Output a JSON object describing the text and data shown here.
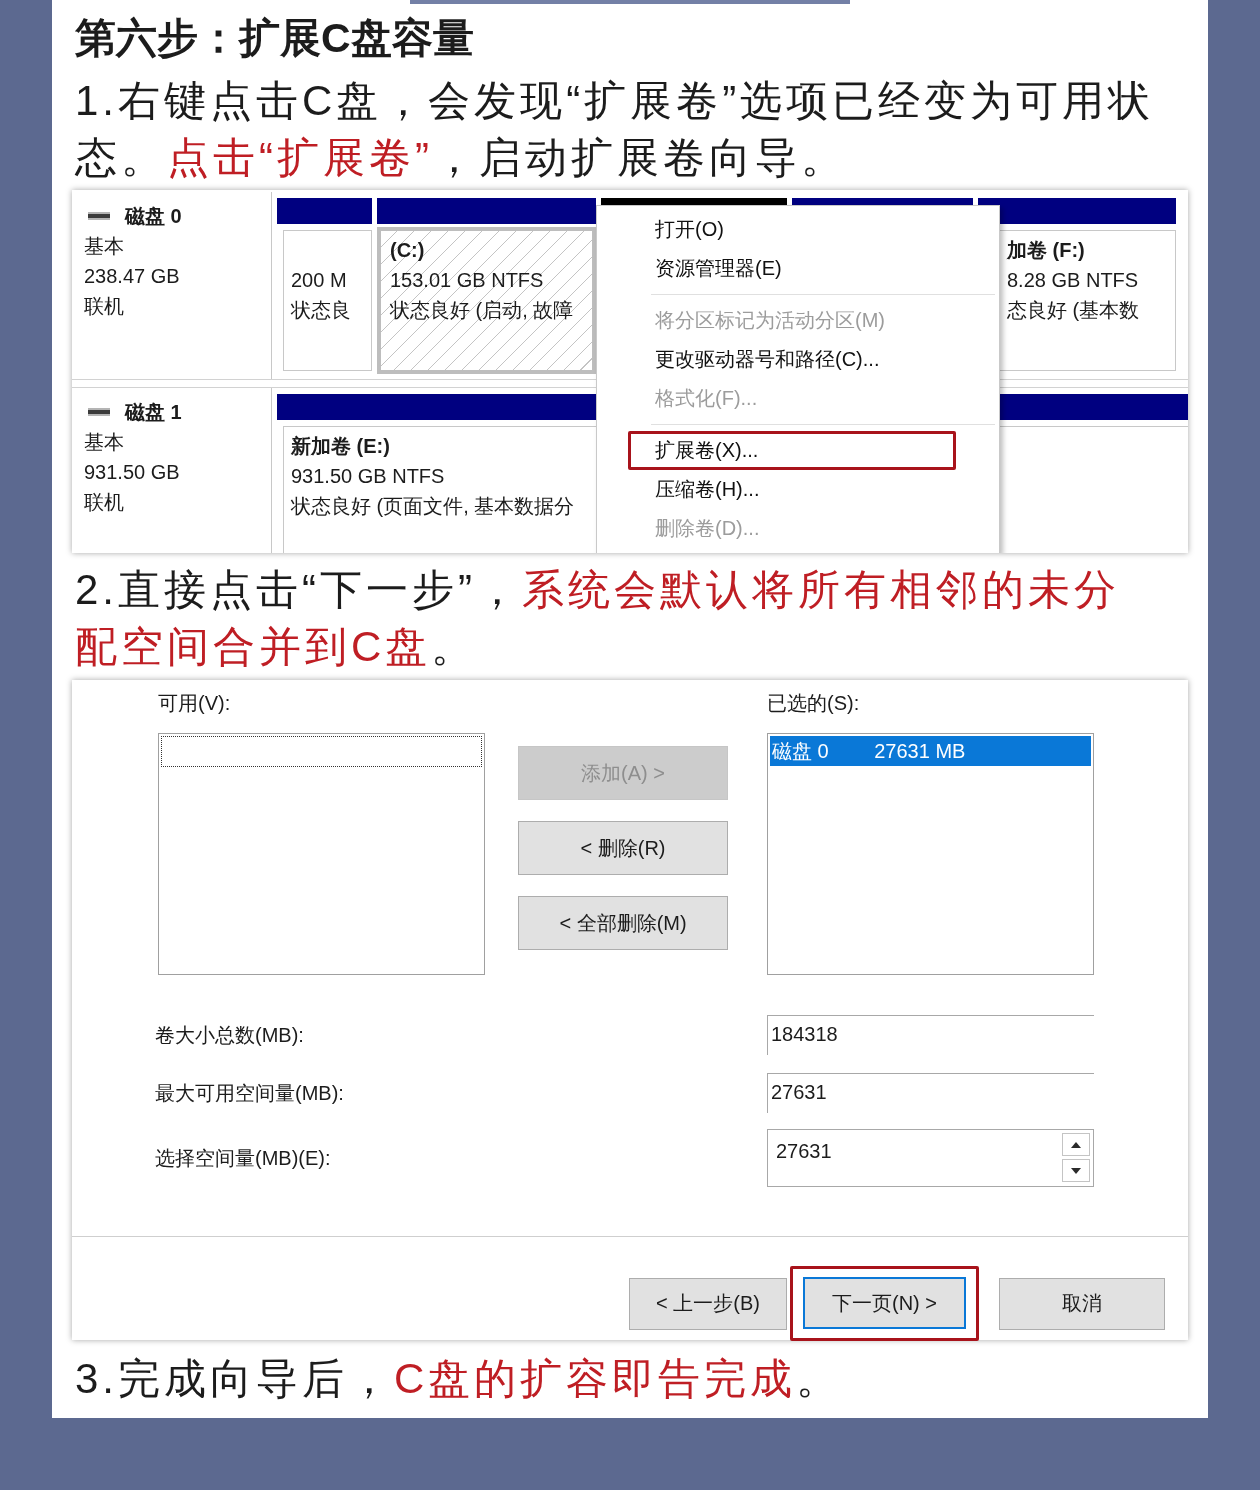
{
  "heading": "第六步：扩展C盘容量",
  "step_1": {
    "text": [
      {
        "text": "1.右键点击C盘，会发现“扩展卷”选项已经变为可用状态。",
        "highlight": false
      },
      {
        "text": "点击“扩展卷”",
        "highlight": true
      },
      {
        "text": "，启动扩展卷向导。",
        "highlight": false
      }
    ]
  },
  "disk_management": {
    "disks": [
      {
        "name": "磁盘 0",
        "type": "基本",
        "size": "238.47 GB",
        "status": "联机",
        "partitions": [
          {
            "kind": "volume",
            "color": "#000080",
            "selected": false,
            "capacity": "200 M",
            "state": "状态良"
          },
          {
            "kind": "volume",
            "color": "#000080",
            "selected": true,
            "title": "(C:)",
            "capacity": "153.01 GB NTFS",
            "state": "状态良好 (启动, 故障"
          },
          {
            "kind": "covered",
            "color": "#000000",
            "selected": false
          },
          {
            "kind": "covered",
            "color": "#000080",
            "selected": false
          },
          {
            "kind": "volume",
            "color": "#000080",
            "selected": false,
            "title": "加卷 (F:)",
            "capacity": "8.28 GB NTFS",
            "state": "态良好 (基本数"
          }
        ]
      },
      {
        "name": "磁盘 1",
        "type": "基本",
        "size": "931.50 GB",
        "status": "联机",
        "partitions": [
          {
            "kind": "volume",
            "color": "#000080",
            "selected": false,
            "title": "新加卷 (E:)",
            "capacity": "931.50 GB NTFS",
            "state": "状态良好 (页面文件, 基本数据分"
          }
        ]
      }
    ],
    "context_menu": {
      "items": [
        {
          "kind": "item",
          "label": "打开(O)",
          "disabled": false,
          "annotated": false
        },
        {
          "kind": "item",
          "label": "资源管理器(E)",
          "disabled": false,
          "annotated": false
        },
        {
          "kind": "separator"
        },
        {
          "kind": "item",
          "label": "将分区标记为活动分区(M)",
          "disabled": true,
          "annotated": false
        },
        {
          "kind": "item",
          "label": "更改驱动器号和路径(C)...",
          "disabled": false,
          "annotated": false
        },
        {
          "kind": "item",
          "label": "格式化(F)...",
          "disabled": true,
          "annotated": false
        },
        {
          "kind": "separator"
        },
        {
          "kind": "item",
          "label": "扩展卷(X)...",
          "disabled": false,
          "annotated": true
        },
        {
          "kind": "item",
          "label": "压缩卷(H)...",
          "disabled": false,
          "annotated": false
        },
        {
          "kind": "item",
          "label": "删除卷(D)...",
          "disabled": true,
          "annotated": false
        }
      ]
    }
  },
  "step_2": {
    "text": [
      {
        "text": "2.直接点击“下一步”，",
        "highlight": false
      },
      {
        "text": "系统会默认将所有相邻的未分配空间合并到C盘",
        "highlight": true
      },
      {
        "text": "。",
        "highlight": false
      }
    ]
  },
  "wizard_dialog": {
    "available": {
      "label": "可用(V):",
      "focused": true
    },
    "move_buttons": [
      {
        "label": "添加(A) >",
        "disabled": true
      },
      {
        "label": "< 删除(R)",
        "disabled": false
      },
      {
        "label": "< 全部删除(M)",
        "disabled": false
      }
    ],
    "selected": {
      "label": "已选的(S):",
      "items": [
        {
          "disk": "磁盘 0",
          "size": "27631 MB",
          "selected": true
        }
      ]
    },
    "fields": [
      {
        "kind": "readonly",
        "label": "卷大小总数(MB):",
        "value": "184318"
      },
      {
        "kind": "readonly",
        "label": "最大可用空间量(MB):",
        "value": "27631"
      },
      {
        "kind": "spin",
        "label": "选择空间量(MB)(E):",
        "value": "27631"
      }
    ],
    "buttons": [
      {
        "label": "< 上一步(B)",
        "default": false,
        "annotated": false
      },
      {
        "label": "下一页(N) >",
        "default": true,
        "annotated": true
      },
      {
        "label": "取消",
        "default": false,
        "annotated": false
      }
    ]
  },
  "step_3": {
    "text": [
      {
        "text": "3.完成向导后，",
        "highlight": false
      },
      {
        "text": "C盘的扩容即告完成",
        "highlight": true
      },
      {
        "text": "。",
        "highlight": false
      }
    ]
  }
}
